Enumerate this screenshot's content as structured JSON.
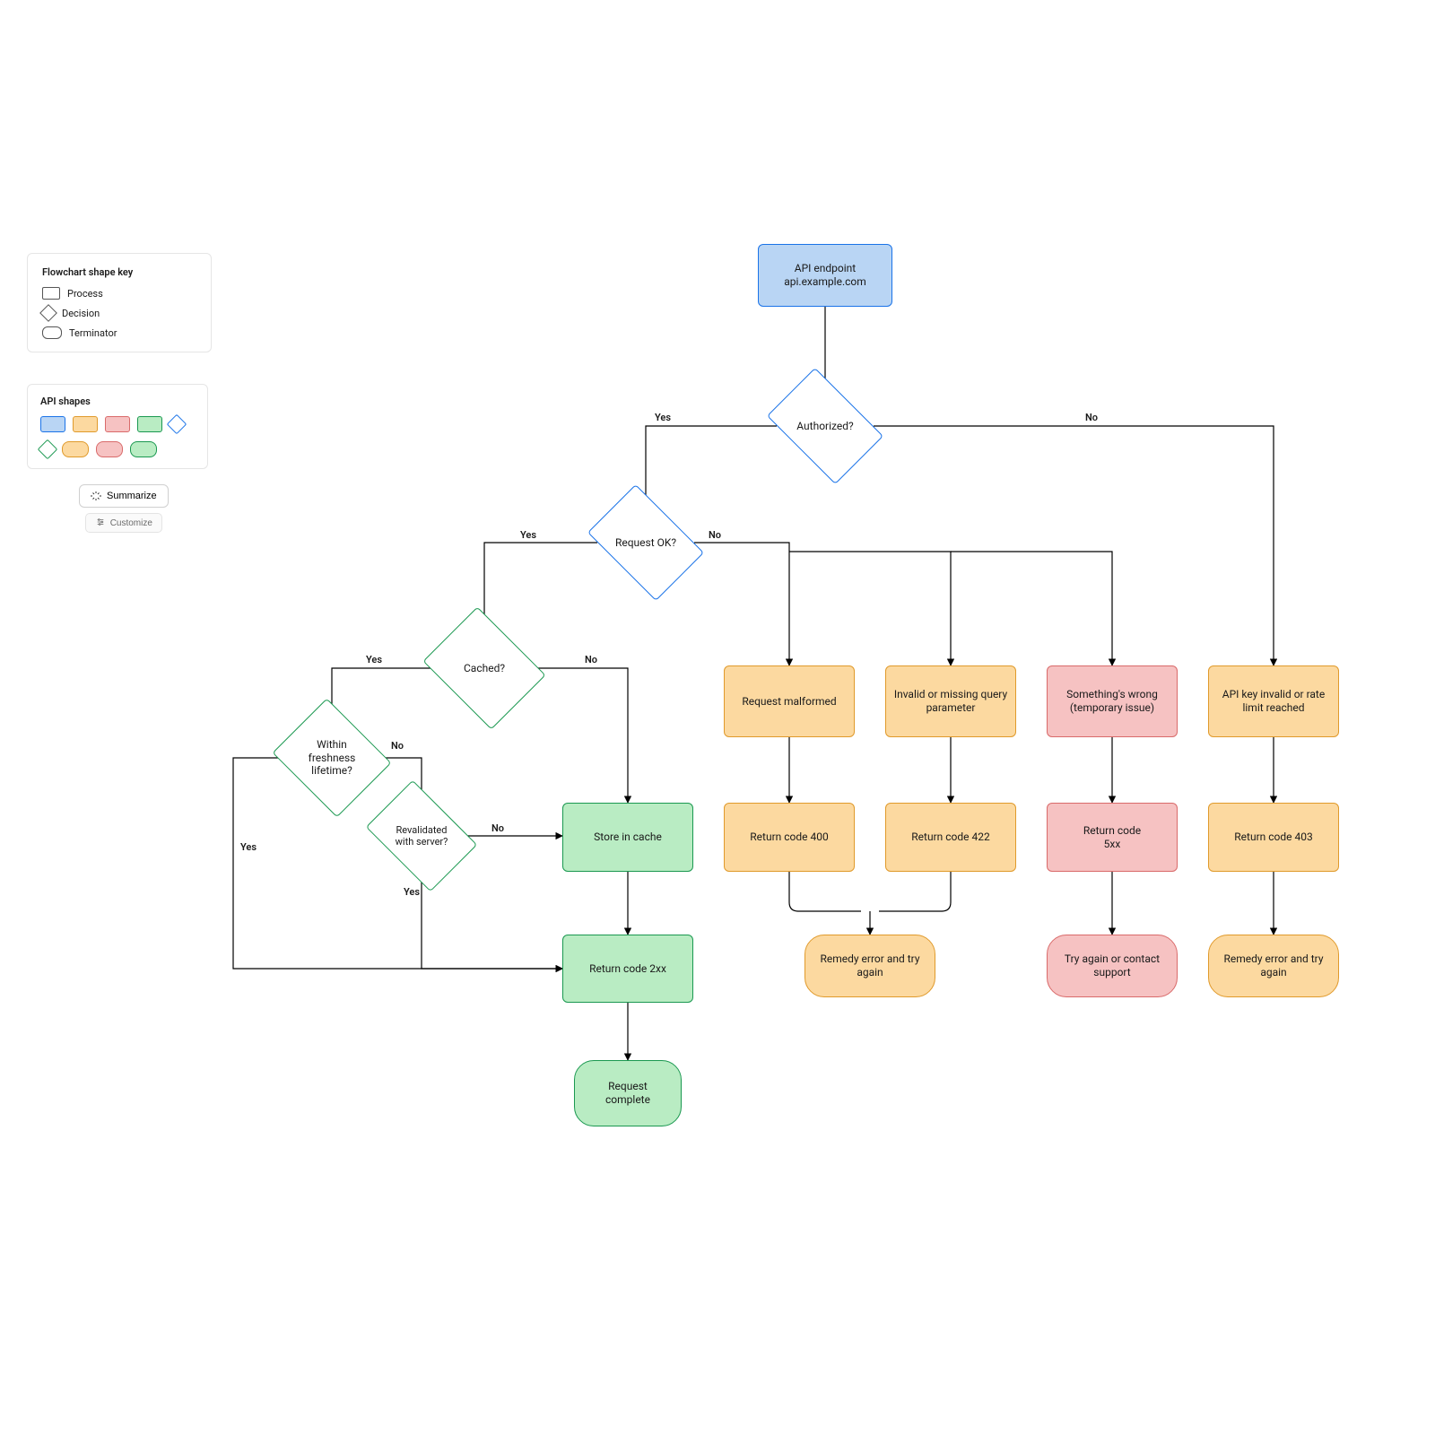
{
  "colors": {
    "blue_fill": "#b9d5f4",
    "blue_stroke": "#1a73e8",
    "orange_fill": "#fcd9a0",
    "orange_stroke": "#e09a2b",
    "red_fill": "#f6c2c2",
    "red_stroke": "#d96a6a",
    "green_fill": "#b9ecc3",
    "green_stroke": "#1a9850"
  },
  "legend": {
    "title": "Flowchart shape key",
    "items": {
      "process": "Process",
      "decision": "Decision",
      "terminator": "Terminator"
    }
  },
  "palette": {
    "title": "API shapes"
  },
  "buttons": {
    "summarize": "Summarize",
    "customize": "Customize"
  },
  "labels": {
    "yes": "Yes",
    "no": "No"
  },
  "nodes": {
    "start": "API endpoint\napi.example.com",
    "authorized": "Authorized?",
    "request_ok": "Request OK?",
    "cached": "Cached?",
    "fresh": "Within\nfreshness\nlifetime?",
    "revalidated": "Revalidated\nwith server?",
    "store_cache": "Store in cache",
    "return_2xx": "Return code 2xx",
    "request_complete": "Request\ncomplete",
    "req_malformed": "Request malformed",
    "invalid_param": "Invalid or missing query parameter",
    "something_wrong": "Something's wrong (temporary issue)",
    "api_key_invalid": "API key invalid or rate limit reached",
    "code_400": "Return code 400",
    "code_422": "Return code 422",
    "code_5xx": "Return code\n5xx",
    "code_403": "Return code 403",
    "remedy1": "Remedy error and try again",
    "try_support": "Try again or contact support",
    "remedy2": "Remedy error and try again"
  }
}
